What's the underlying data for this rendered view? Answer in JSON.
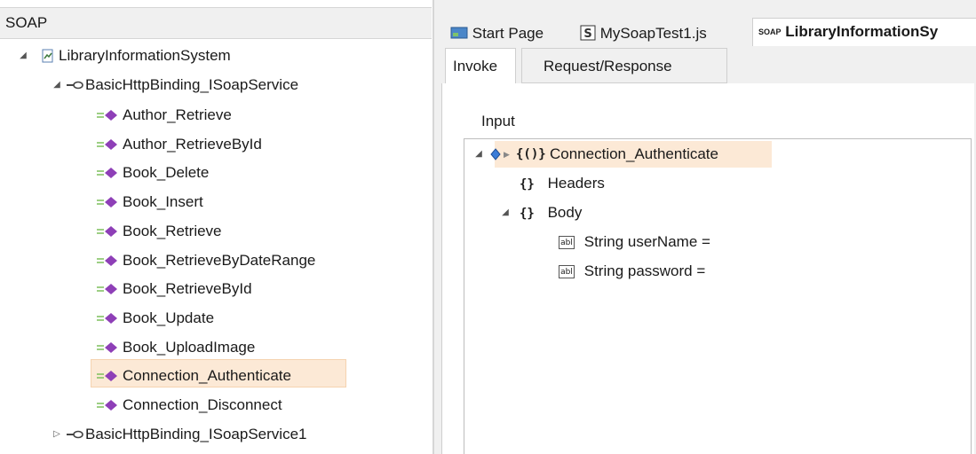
{
  "left_panel": {
    "header": "SOAP",
    "root": "LibraryInformationSystem",
    "binding1": "BasicHttpBinding_ISoapService",
    "operations": [
      "Author_Retrieve",
      "Author_RetrieveById",
      "Book_Delete",
      "Book_Insert",
      "Book_Retrieve",
      "Book_RetrieveByDateRange",
      "Book_RetrieveById",
      "Book_Update",
      "Book_UploadImage",
      "Connection_Authenticate",
      "Connection_Disconnect"
    ],
    "selected_operation": "Connection_Authenticate",
    "binding2": "BasicHttpBinding_ISoapService1"
  },
  "doc_tabs": {
    "start": "Start Page",
    "script": "MySoapTest1.js",
    "active_badge": "SOAP",
    "active": "LibraryInformationSy"
  },
  "sub_tabs": {
    "invoke": "Invoke",
    "reqres": "Request/Response"
  },
  "input": {
    "label": "Input",
    "root": "Connection_Authenticate",
    "headers": "Headers",
    "body": "Body",
    "fields": [
      "String userName =",
      "String password ="
    ]
  },
  "colors": {
    "selection_bg": "#fce9d6",
    "operation_icon": "#8e3fb7",
    "panel_bg": "#f0f0f0"
  }
}
